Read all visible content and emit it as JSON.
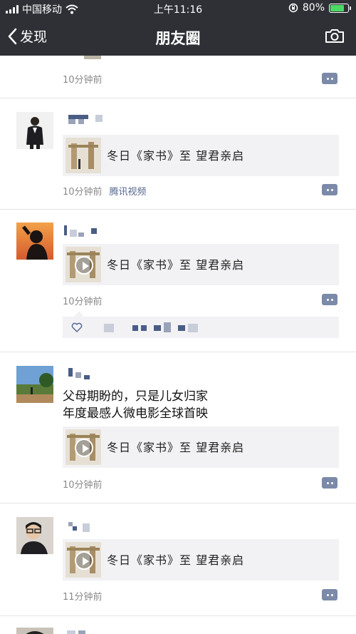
{
  "status_bar": {
    "carrier": "中国移动",
    "time": "上午11:16",
    "battery_percent": "80%",
    "battery_level": 0.8
  },
  "nav": {
    "back_label": "发现",
    "title": "朋友圈"
  },
  "posts": [
    {
      "time": "10分钟前"
    },
    {
      "card_title": "冬日《家书》至 望君亲启",
      "time": "10分钟前",
      "source": "腾讯视频"
    },
    {
      "card_title": "冬日《家书》至 望君亲启",
      "time": "10分钟前"
    },
    {
      "text_line1": "父母期盼的，只是儿女归家",
      "text_line2": "年度最感人微电影全球首映",
      "card_title": "冬日《家书》至 望君亲启",
      "time": "10分钟前"
    },
    {
      "card_title": "冬日《家书》至 望君亲启",
      "time": "11分钟前"
    }
  ],
  "icons": {
    "back": "chevron-left-icon",
    "camera": "camera-icon",
    "more": "comment-more-icon",
    "like": "heart-icon",
    "play": "play-icon"
  },
  "colors": {
    "nav_bg": "#2e3036",
    "link": "#56688f",
    "card_bg": "#f2f2f5",
    "battery": "#4cd964"
  }
}
